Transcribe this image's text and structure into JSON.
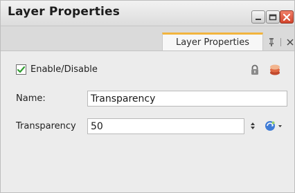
{
  "window": {
    "title": "Layer Properties"
  },
  "controls": {
    "minimize": "minimize-icon",
    "maximize": "maximize-icon",
    "close": "close-icon"
  },
  "tab": {
    "label": "Layer Properties",
    "icons": [
      "pin-icon",
      "close-icon"
    ]
  },
  "form": {
    "enable": {
      "label": "Enable/Disable",
      "checked": true
    },
    "name": {
      "label": "Name:",
      "value": "Transparency"
    },
    "transparency": {
      "label": "Transparency",
      "value": "50"
    }
  },
  "icons": {
    "lock": "lock-icon",
    "layer": "layer-icon",
    "spinner": "spinner-icon",
    "expression": "expression-icon"
  },
  "colors": {
    "tab_accent": "#f2b43d",
    "check": "#2f9e2f",
    "close_button": "#d4452c"
  }
}
